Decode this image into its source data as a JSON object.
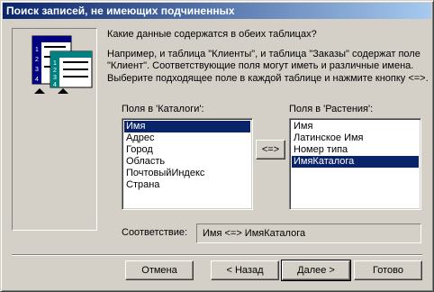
{
  "window": {
    "title": "Поиск записей, не имеющих подчиненных"
  },
  "instructions": {
    "question": "Какие данные содержатся в обеих таблицах?",
    "example_line1": "Например, и таблица \"Клиенты\", и таблица \"Заказы\" содержат поле",
    "example_line2": "\"Клиент\". Соответствующие поля могут иметь и различные имена.",
    "select_hint": "Выберите подходящее поле в каждой таблице и нажмите кнопку <=>."
  },
  "illustration": {
    "back_table_numbers": [
      "1",
      "2",
      "3",
      "4"
    ],
    "front_table_numbers": [
      "1",
      "2",
      "3",
      "4"
    ]
  },
  "left_list": {
    "label": "Поля в 'Каталоги':",
    "items": [
      "Имя",
      "Адрес",
      "Город",
      "Область",
      "ПочтовыйИндекс",
      "Страна"
    ],
    "selected_index": 0
  },
  "right_list": {
    "label": "Поля в 'Растения':",
    "items": [
      "Имя",
      "Латинское Имя",
      "Номер типа",
      "ИмяКаталога"
    ],
    "selected_index": 3
  },
  "match_button": {
    "label": "<=>"
  },
  "match": {
    "label": "Соответствие:",
    "value": "Имя <=> ИмяКаталога"
  },
  "buttons": {
    "cancel": "Отмена",
    "back": "< Назад",
    "next": "Далее >",
    "finish": "Готово"
  }
}
